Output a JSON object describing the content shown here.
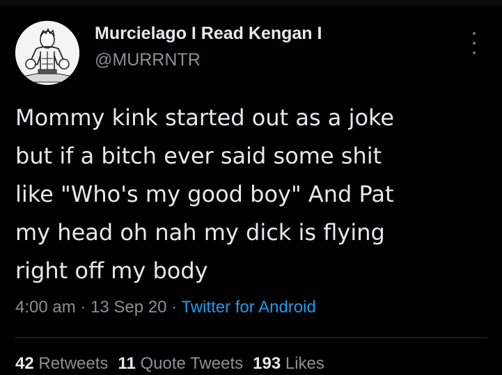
{
  "user": {
    "display_name": "Murcielago I Read Kengan I",
    "handle": "@MURRNTR"
  },
  "tweet": {
    "text": "Mommy kink started out as a joke\nbut if a bitch ever said some shit\nlike \"Who's my good boy\" And Pat\nmy head oh nah my dick is flying\nright off my body",
    "time": "4:00 am",
    "separator": "·",
    "date": "13 Sep 20",
    "source": "Twitter for Android"
  },
  "stats": {
    "retweets_count": "42",
    "retweets_label": "Retweets",
    "quotes_count": "11",
    "quotes_label": "Quote Tweets",
    "likes_count": "193",
    "likes_label": "Likes"
  },
  "icons": {
    "more": "more-options-icon",
    "avatar": "avatar"
  },
  "colors": {
    "background": "#000000",
    "text": "#e7e9ea",
    "muted": "#8b9096",
    "link": "#1d9bf0",
    "divider": "#2f3336"
  }
}
